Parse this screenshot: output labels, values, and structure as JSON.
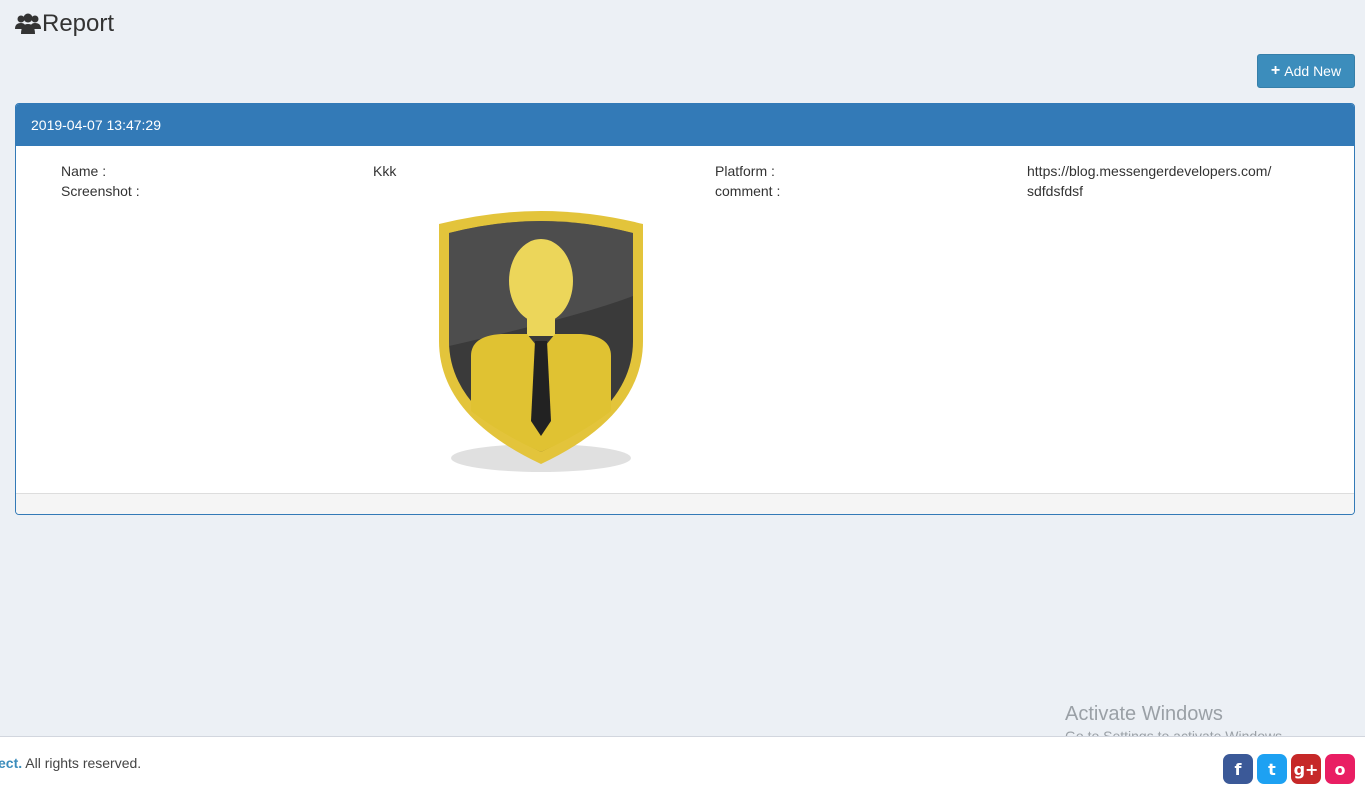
{
  "header": {
    "title": "Report",
    "icon": "users-icon"
  },
  "toolbar": {
    "add_label": "Add New",
    "accent": "#3c8dbc"
  },
  "report": {
    "timestamp": "2019-04-07 13:47:29",
    "name_label": "Name :",
    "name_value": "Kkk",
    "platform_label": "Platform :",
    "platform_value": "https://blog.messengerdevelopers.com/",
    "screenshot_label": "Screenshot :",
    "comment_label": "comment :",
    "comment_value": "sdfdsfdsf"
  },
  "watermark": {
    "title": "Activate Windows",
    "subtitle": "Go to Settings to activate Windows."
  },
  "footer": {
    "brand": "ect.",
    "rights": " All rights reserved."
  },
  "social": [
    {
      "name": "facebook-icon",
      "glyph": "f",
      "color": "#3b5998"
    },
    {
      "name": "twitter-icon",
      "glyph": "t",
      "color": "#1da1f2"
    },
    {
      "name": "google-plus-icon",
      "glyph": "g+",
      "color": "#c62828"
    },
    {
      "name": "instagram-icon",
      "glyph": "o",
      "color": "#e91e63"
    }
  ]
}
